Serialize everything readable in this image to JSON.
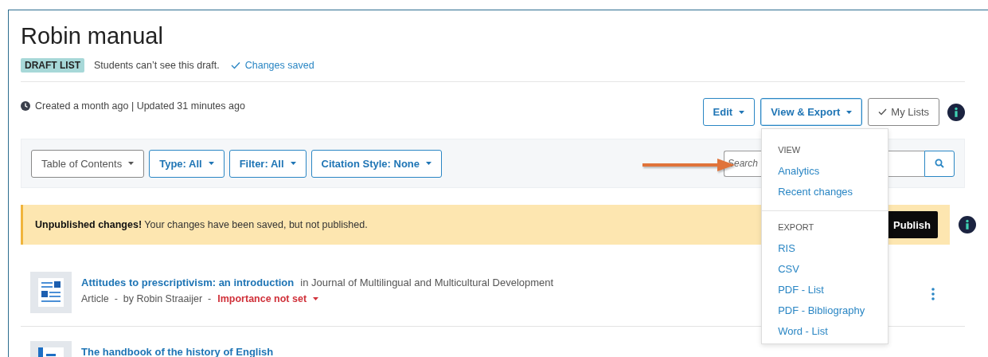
{
  "title": "Robin manual",
  "status": {
    "badge": "DRAFT LIST",
    "note": "Students can’t see this draft.",
    "saved": "Changes saved"
  },
  "meta": "Created a month ago | Updated 31 minutes ago",
  "actions": [
    {
      "label": "Edit",
      "kind": "dropdown",
      "expanded": false
    },
    {
      "label": "View & Export",
      "kind": "dropdown",
      "expanded": true
    },
    {
      "label": "My Lists",
      "kind": "check"
    }
  ],
  "toolbar": {
    "filters": [
      {
        "label": "Table of Contents",
        "kind": "plain"
      },
      {
        "label": "Type: All",
        "kind": "accent"
      },
      {
        "label": "Filter: All",
        "kind": "accent"
      },
      {
        "label": "Citation Style: None",
        "kind": "accent"
      }
    ],
    "search": {
      "placeholder": "Search"
    }
  },
  "menu": {
    "sections": [
      {
        "heading": "VIEW",
        "items": [
          "Analytics",
          "Recent changes"
        ]
      },
      {
        "heading": "EXPORT",
        "items": [
          "RIS",
          "CSV",
          "PDF - List",
          "PDF - Bibliography",
          "Word - List"
        ]
      }
    ]
  },
  "banner": {
    "text": "**Unpublished changes!** Your changes have been saved, but not published.",
    "button": "Publish"
  },
  "items": [
    {
      "kind": "article",
      "title": "Attitudes to prescriptivism: an introduction",
      "source": "in Journal of Multilingual and Multicultural Development",
      "details": "Article  -  by Robin Straaijer  -",
      "importance": "Importance not set"
    },
    {
      "kind": "book",
      "title": "The handbook of the history of English"
    }
  ]
}
